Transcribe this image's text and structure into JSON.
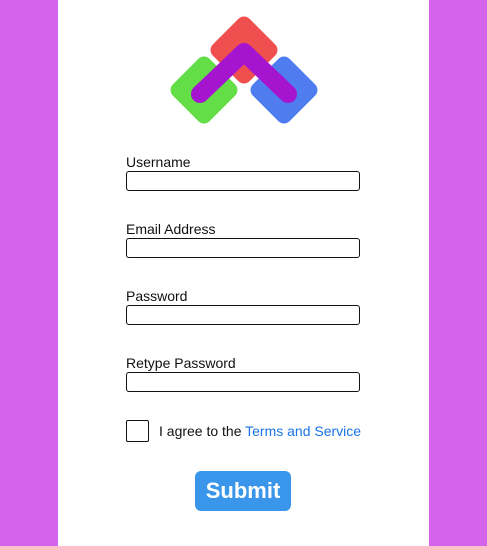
{
  "logo": {
    "icon": "stacked-chevron-logo",
    "colors": {
      "red": "#ef4f4f",
      "green": "#63de47",
      "blue": "#4f7df0",
      "purple": "#a514cf"
    }
  },
  "form": {
    "fields": [
      {
        "label": "Username",
        "value": "",
        "type": "text"
      },
      {
        "label": "Email Address",
        "value": "",
        "type": "email"
      },
      {
        "label": "Password",
        "value": "",
        "type": "password"
      },
      {
        "label": "Retype Password",
        "value": "",
        "type": "password"
      }
    ],
    "agree": {
      "checked": false,
      "text": "I agree to the ",
      "link_text": "Terms and Service"
    },
    "submit_label": "Submit"
  },
  "colors": {
    "page_background": "#d563ec",
    "card_background": "#ffffff",
    "submit_background": "#3a96ea",
    "link": "#1a73e8"
  }
}
